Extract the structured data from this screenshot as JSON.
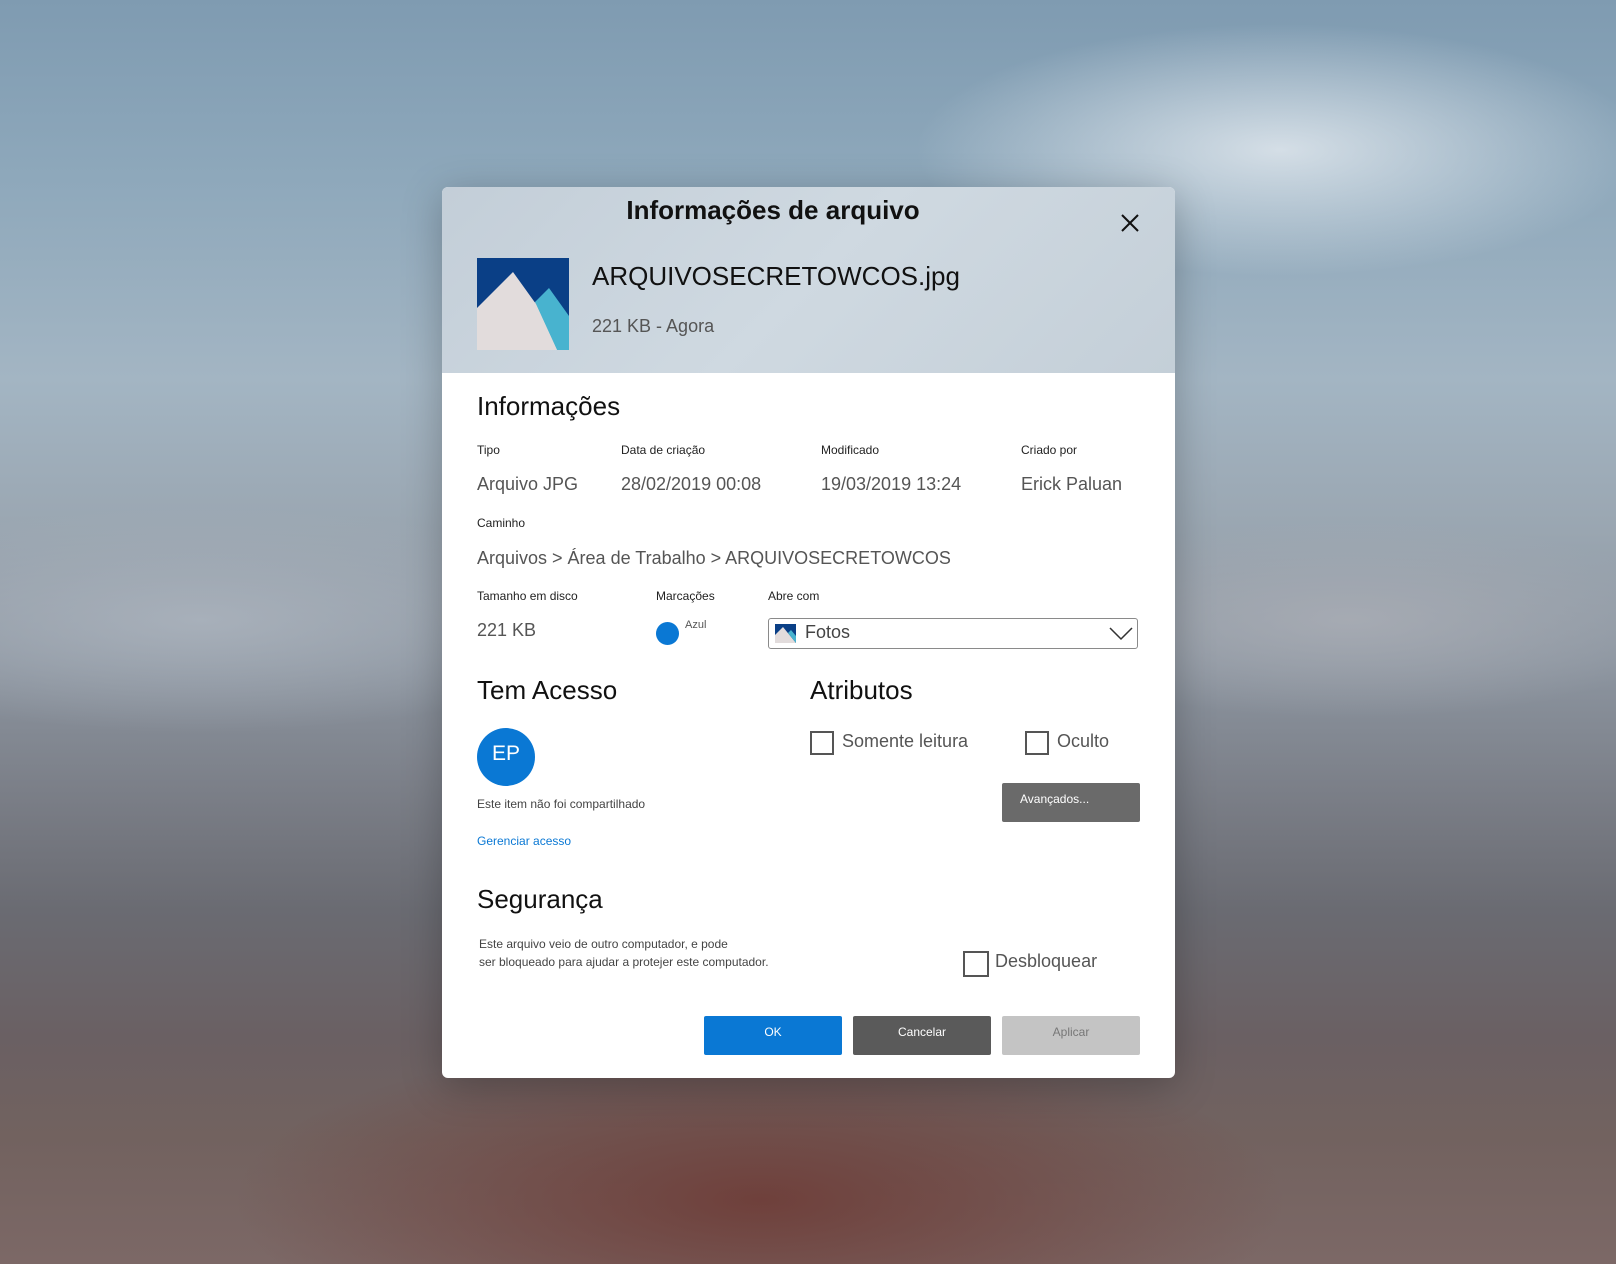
{
  "dialog": {
    "title": "Informações de arquivo",
    "close_icon": "close-icon"
  },
  "file": {
    "name": "ARQUIVOSECRETOWCOS.jpg",
    "meta": "221 KB - Agora",
    "thumbnail_icon": "image-file-icon"
  },
  "info": {
    "title": "Informações",
    "type_label": "Tipo",
    "type_value": "Arquivo JPG",
    "created_label": "Data de criação",
    "created_value": "28/02/2019 00:08",
    "modified_label": "Modificado",
    "modified_value": "19/03/2019 13:24",
    "author_label": "Criado por",
    "author_value": "Erick Paluan",
    "path_label": "Caminho",
    "path_value": "Arquivos > Área de Trabalho > ARQUIVOSECRETOWCOS",
    "size_label": "Tamanho em disco",
    "size_value": "221 KB",
    "tags_label": "Marcações",
    "tag_name": "Azul",
    "tag_color": "#0a78d4",
    "opens_with_label": "Abre com",
    "opens_with_value": "Fotos"
  },
  "access": {
    "title": "Tem Acesso",
    "avatar_initials": "EP",
    "avatar_color": "#0a78d4",
    "not_shared_text": "Este item não foi compartilhado",
    "manage_link": "Gerenciar acesso"
  },
  "attributes": {
    "title": "Atributos",
    "readonly_label": "Somente leitura",
    "readonly_checked": false,
    "hidden_label": "Oculto",
    "hidden_checked": false,
    "advanced_button": "Avançados..."
  },
  "security": {
    "title": "Segurança",
    "line1": "Este arquivo veio de outro computador, e pode",
    "line2": "ser bloqueado para ajudar a protejer este computador.",
    "unblock_label": "Desbloquear",
    "unblock_checked": false
  },
  "buttons": {
    "ok": "OK",
    "cancel": "Cancelar",
    "apply": "Aplicar"
  },
  "colors": {
    "accent": "#0a78d4",
    "secondary_button": "#5a5a5a",
    "disabled_button": "#c4c4c4"
  }
}
